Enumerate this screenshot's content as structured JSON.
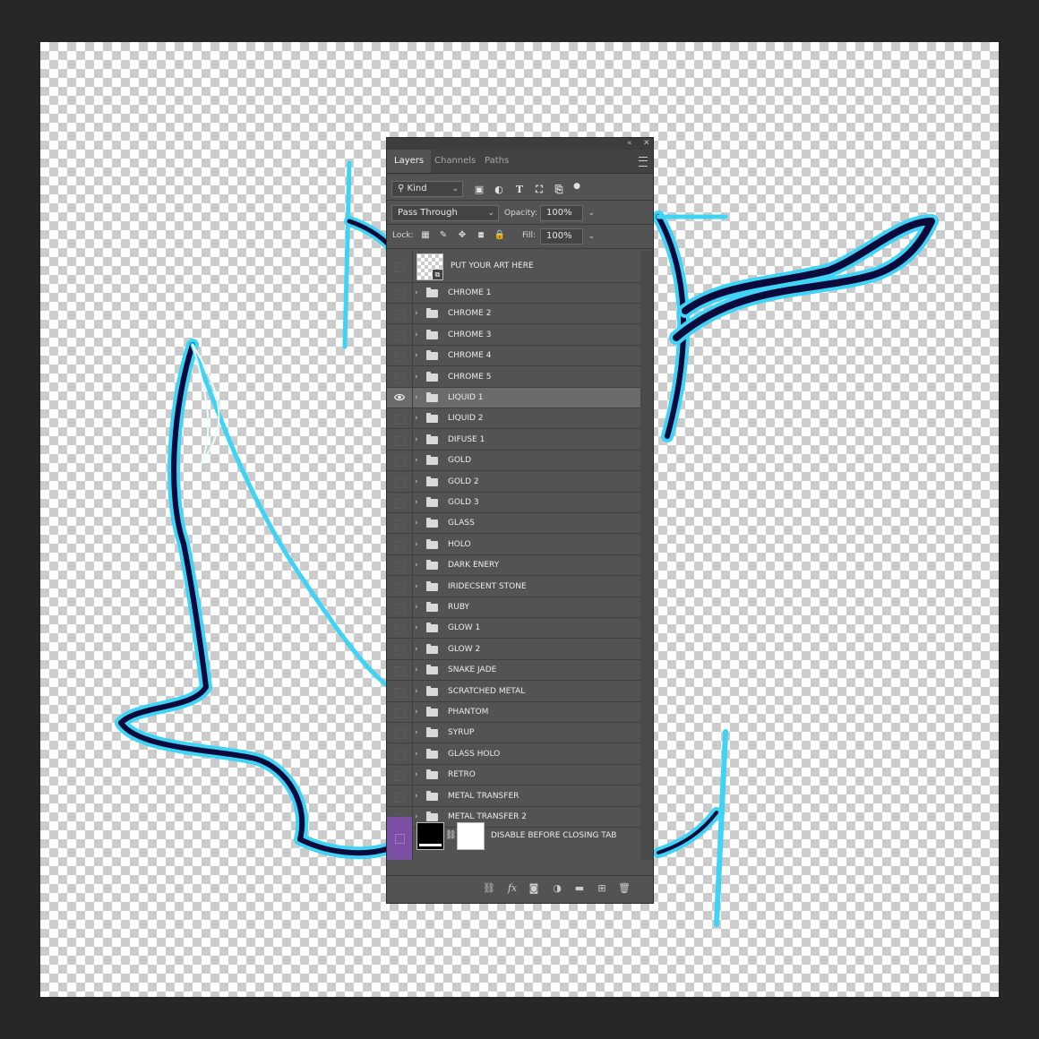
{
  "panel": {
    "tabs": [
      "Layers",
      "Channels",
      "Paths"
    ],
    "active_tab": "Layers",
    "filter": {
      "label": "Kind"
    },
    "blend_mode": "Pass Through",
    "opacity_label": "Opacity:",
    "opacity_value": "100%",
    "lock_label": "Lock:",
    "fill_label": "Fill:",
    "fill_value": "100%",
    "top_layer": "PUT YOUR ART HERE",
    "groups": [
      {
        "name": "CHROME 1",
        "visible": false
      },
      {
        "name": "CHROME 2",
        "visible": false
      },
      {
        "name": "CHROME 3",
        "visible": false
      },
      {
        "name": "CHROME 4",
        "visible": false
      },
      {
        "name": "CHROME 5",
        "visible": false
      },
      {
        "name": "LIQUID 1",
        "visible": true,
        "selected": true
      },
      {
        "name": "LIQUID 2",
        "visible": false
      },
      {
        "name": "DIFUSE 1",
        "visible": false
      },
      {
        "name": "GOLD",
        "visible": false
      },
      {
        "name": "GOLD 2",
        "visible": false
      },
      {
        "name": "GOLD 3",
        "visible": false
      },
      {
        "name": "GLASS",
        "visible": false
      },
      {
        "name": "HOLO",
        "visible": false
      },
      {
        "name": "DARK ENERY",
        "visible": false
      },
      {
        "name": "IRIDECSENT STONE",
        "visible": false
      },
      {
        "name": "RUBY",
        "visible": false
      },
      {
        "name": "GLOW 1",
        "visible": false
      },
      {
        "name": "GLOW 2",
        "visible": false
      },
      {
        "name": "SNAKE JADE",
        "visible": false
      },
      {
        "name": "SCRATCHED METAL",
        "visible": false
      },
      {
        "name": "PHANTOM",
        "visible": false
      },
      {
        "name": "SYRUP",
        "visible": false
      },
      {
        "name": "GLASS HOLO",
        "visible": false
      },
      {
        "name": "RETRO",
        "visible": false
      },
      {
        "name": "METAL TRANSFER",
        "visible": false
      },
      {
        "name": "METAL TRANSFER 2",
        "visible": false
      }
    ],
    "bottom_layer": "DISABLE BEFORE CLOSING TAB",
    "bottom_layer_color": "#7b4fa3"
  },
  "colors": {
    "artwork_glow": "#3fd4f5",
    "artwork_dark": "#0a0a3c"
  }
}
